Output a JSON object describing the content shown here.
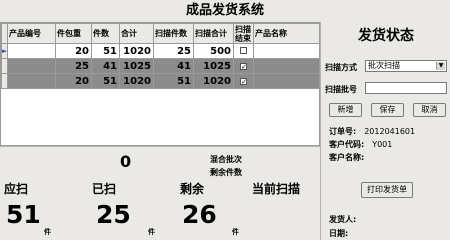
{
  "window": {
    "title": "成品发货系统"
  },
  "grid": {
    "columns": [
      "产品编号",
      "件包重",
      "件数",
      "合计",
      "扫描件数",
      "扫描合计",
      "扫描结束",
      "产品名称"
    ],
    "rows": [
      {
        "code": "",
        "pack": "20",
        "qty": "51",
        "total": "1020",
        "scan_qty": "25",
        "scan_total": "500",
        "done": false,
        "name": ""
      },
      {
        "code": "",
        "pack": "25",
        "qty": "41",
        "total": "1025",
        "scan_qty": "41",
        "scan_total": "1025",
        "done": true,
        "name": ""
      },
      {
        "code": "",
        "pack": "20",
        "qty": "51",
        "total": "1020",
        "scan_qty": "51",
        "scan_total": "1020",
        "done": true,
        "name": ""
      }
    ]
  },
  "status": {
    "title": "发货状态",
    "scan_mode_label": "扫描方式",
    "scan_mode_value": "批次扫描",
    "scan_batch_label": "扫描批号",
    "scan_batch_value": "",
    "buttons": {
      "new": "新增",
      "save": "保存",
      "cancel": "取消"
    },
    "order_no_label": "订单号:",
    "order_no": "2012041601",
    "customer_code_label": "客户代码:",
    "customer_code": "Y001",
    "customer_name_label": "客户名称:",
    "customer_name": "",
    "print_button": "打印发货单",
    "shipper_label": "发货人:",
    "shipper": "",
    "date_label": "日期:",
    "date": ""
  },
  "middle": {
    "current_code": "0",
    "mixed_batch_label": "混合批次",
    "remaining_label": "剩余件数"
  },
  "summary": {
    "should_scan_label": "应扫",
    "scanned_label": "已扫",
    "remaining_label": "剩余",
    "current_scan_label": "当前扫描",
    "should_scan": "51",
    "scanned": "25",
    "remaining": "26",
    "unit": "件"
  }
}
